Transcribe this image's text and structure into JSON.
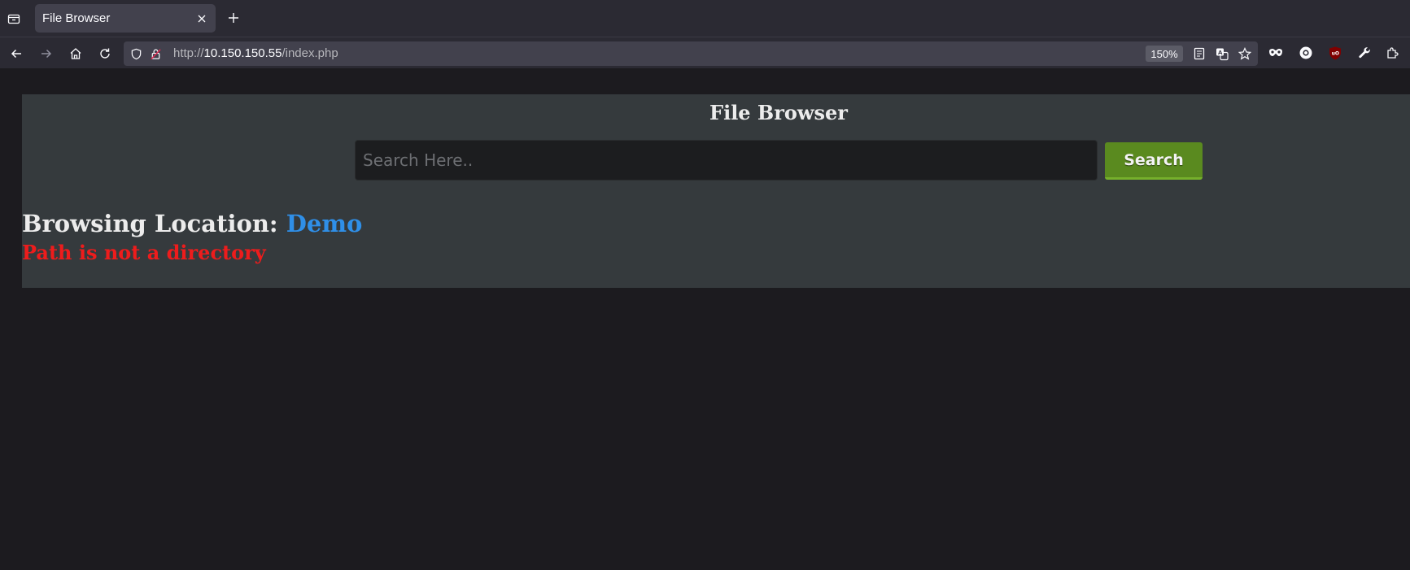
{
  "browser": {
    "tab": {
      "title": "File Browser"
    },
    "url": {
      "scheme": "http://",
      "host": "10.150.150.55",
      "path": "/index.php"
    },
    "zoom": "150%",
    "extensions": [
      "reader-view-icon",
      "translate-icon",
      "bookmark-star-icon",
      "incognito-mask-icon",
      "circle-o-extension-icon",
      "ublock-origin-icon",
      "wrench-icon",
      "extensions-puzzle-icon"
    ]
  },
  "page": {
    "title": "File Browser",
    "search": {
      "placeholder": "Search Here..",
      "value": "",
      "button_label": "Search"
    },
    "location": {
      "label": "Browsing Location: ",
      "value": "Demo"
    },
    "error": "Path is not a directory"
  },
  "colors": {
    "panel": "#353a3d",
    "search_button": "#5a8a1f",
    "location_value": "#2f8fe8",
    "error": "#ee1c1c"
  }
}
